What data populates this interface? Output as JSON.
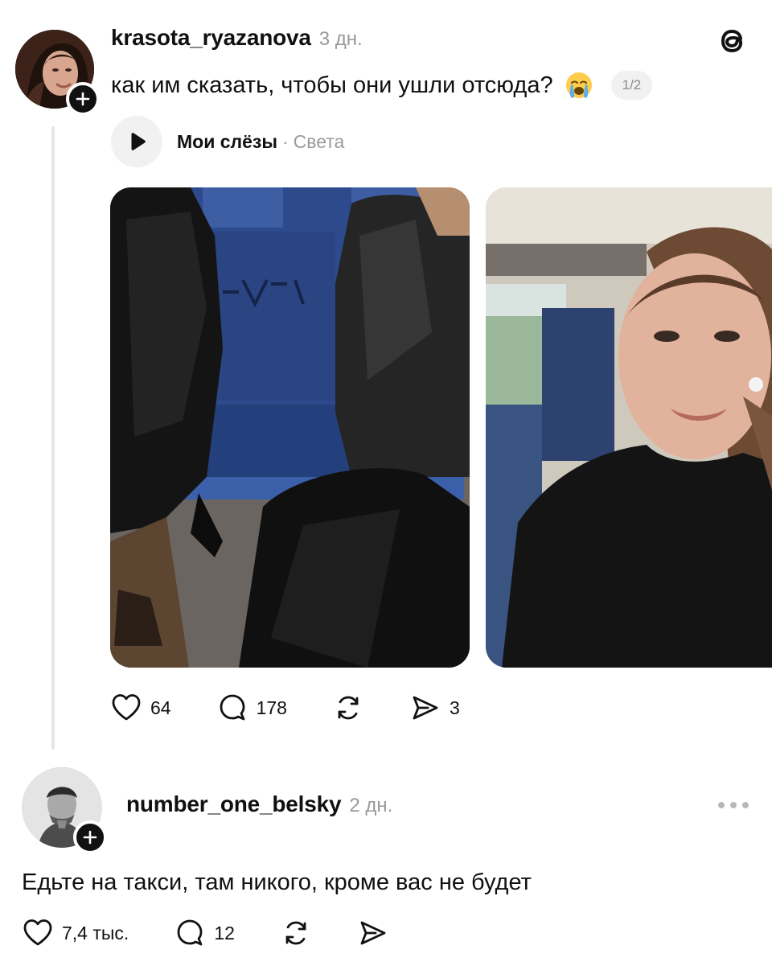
{
  "post": {
    "username": "krasota_ryazanova",
    "timestamp": "3 дн.",
    "text": "как им сказать, чтобы они ушли отсюда?",
    "emoji": "😭",
    "carousel_counter": "1/2",
    "music": {
      "title": "Мои слёзы",
      "separator": "·",
      "artist": "Света"
    },
    "stats": {
      "likes": "64",
      "comments": "178",
      "shares": "3"
    }
  },
  "reply": {
    "username": "number_one_belsky",
    "timestamp": "2 дн.",
    "text": "Едьте на такси, там никого, кроме вас не будет",
    "stats": {
      "likes": "7,4 тыс.",
      "comments": "12"
    }
  },
  "icons": {
    "app_logo": "threads-logo-icon",
    "like": "heart-icon",
    "comment": "comment-bubble-icon",
    "repost": "repost-icon",
    "share": "send-icon",
    "more": "more-dots-icon",
    "play": "play-icon",
    "follow": "plus-icon"
  },
  "colors": {
    "primary_text": "#101010",
    "secondary_text": "#999999",
    "thread_line": "#e5e5e5",
    "pill_bg": "#f1f1f1"
  }
}
